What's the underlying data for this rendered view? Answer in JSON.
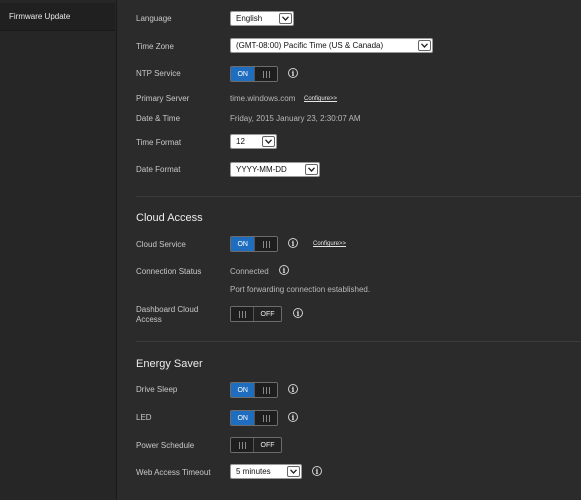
{
  "sidebar": {
    "items": [
      {
        "label": "Firmware Update"
      }
    ]
  },
  "general": {
    "language": {
      "label": "Language",
      "value": "English"
    },
    "time_zone": {
      "label": "Time Zone",
      "value": "(GMT-08:00) Pacific Time (US & Canada)"
    },
    "ntp_service": {
      "label": "NTP Service",
      "state": "ON"
    },
    "primary_server": {
      "label": "Primary Server",
      "value": "time.windows.com",
      "link": "Configure>>"
    },
    "date_time": {
      "label": "Date & Time",
      "value": "Friday, 2015 January 23, 2:30:07 AM"
    },
    "time_format": {
      "label": "Time Format",
      "value": "12"
    },
    "date_format": {
      "label": "Date Format",
      "value": "YYYY-MM-DD"
    }
  },
  "cloud_access": {
    "title": "Cloud Access",
    "cloud_service": {
      "label": "Cloud Service",
      "state": "ON",
      "link": "Configure>>"
    },
    "connection_status": {
      "label": "Connection Status",
      "value": "Connected",
      "detail": "Port forwarding connection established."
    },
    "dashboard_cloud_access": {
      "label_line1": "Dashboard Cloud",
      "label_line2": "Access",
      "state": "OFF"
    }
  },
  "energy_saver": {
    "title": "Energy Saver",
    "drive_sleep": {
      "label": "Drive Sleep",
      "state": "ON"
    },
    "led": {
      "label": "LED",
      "state": "ON"
    },
    "power_schedule": {
      "label": "Power Schedule",
      "state": "OFF"
    },
    "web_access_timeout": {
      "label": "Web Access Timeout",
      "value": "5 minutes"
    }
  },
  "icons": {
    "info": "i"
  },
  "colors": {
    "toggle_on": "#1f6dbf",
    "background": "#2b2b2b"
  }
}
